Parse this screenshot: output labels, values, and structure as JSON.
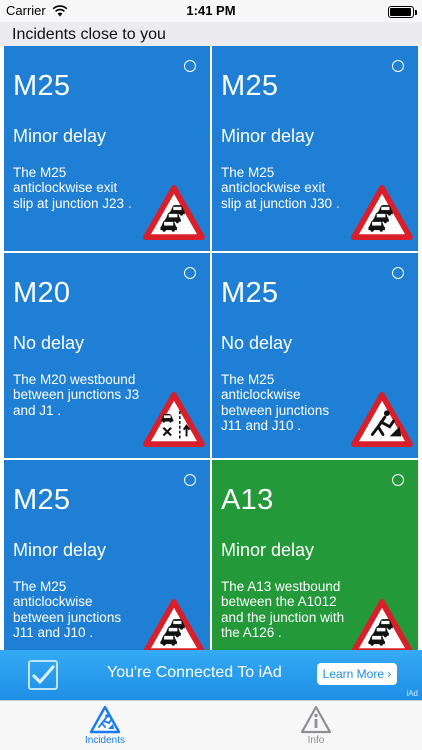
{
  "status_bar": {
    "carrier": "Carrier",
    "time": "1:41 PM",
    "battery_level": 0.95
  },
  "section_header": "Incidents close to you",
  "incidents": [
    {
      "road": "M25",
      "status": "Minor delay",
      "description": "The M25 anticlockwise exit slip at junction J23 .",
      "color": "#1e7fd4",
      "icon": "queueing-traffic-sign-icon"
    },
    {
      "road": "M25",
      "status": "Minor delay",
      "description": "The M25 anticlockwise exit slip at junction J30 .",
      "color": "#1e7fd4",
      "icon": "queueing-traffic-sign-icon"
    },
    {
      "road": "M20",
      "status": "No delay",
      "description": "The M20 westbound between junctions J3  and J1 .",
      "color": "#1e7fd4",
      "icon": "lane-closure-sign-icon"
    },
    {
      "road": "M25",
      "status": "No delay",
      "description": "The M25 anticlockwise between junctions J11  and J10 .",
      "color": "#1e7fd4",
      "icon": "roadworks-sign-icon"
    },
    {
      "road": "M25",
      "status": "Minor delay",
      "description": "The M25 anticlockwise between junctions J11  and J10 .",
      "color": "#1e7fd4",
      "icon": "queueing-traffic-sign-icon"
    },
    {
      "road": "A13",
      "status": "Minor delay",
      "description": "The A13 westbound between the A1012 and the junction with the A126 .",
      "color": "#23993a",
      "icon": "queueing-traffic-sign-icon"
    }
  ],
  "ad_banner": {
    "text": "You're Connected To iAd",
    "button": "Learn More ›",
    "mark": "iAd"
  },
  "tab_bar": {
    "tabs": [
      {
        "label": "Incidents",
        "icon": "incidents-tab-icon",
        "active": true,
        "color": "#1a7bf0"
      },
      {
        "label": "Info",
        "icon": "info-tab-icon",
        "active": false,
        "color": "#8e8e93"
      }
    ]
  }
}
